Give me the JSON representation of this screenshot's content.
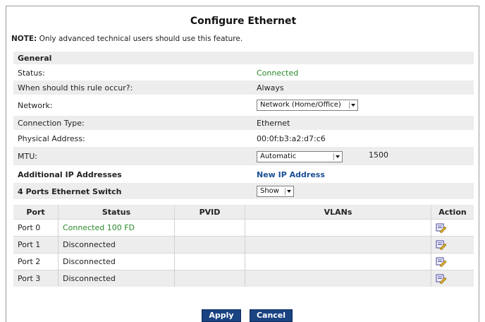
{
  "page": {
    "title": "Configure Ethernet",
    "note_label": "NOTE:",
    "note_text": " Only advanced technical users should use this feature."
  },
  "general": {
    "header": "General",
    "status_label": "Status:",
    "status_value": "Connected",
    "rule_label": "When should this rule occur?:",
    "rule_value": "Always",
    "network_label": "Network:",
    "network_value": "Network (Home/Office)",
    "conn_type_label": "Connection Type:",
    "conn_type_value": "Ethernet",
    "phys_addr_label": "Physical Address:",
    "phys_addr_value": "00:0f:b3:a2:d7:c6",
    "mtu_label": "MTU:",
    "mtu_mode": "Automatic",
    "mtu_value": "1500"
  },
  "additional_ip": {
    "label": "Additional IP Addresses",
    "link": "New IP Address"
  },
  "switch": {
    "label": "4 Ports Ethernet Switch",
    "toggle_value": "Show"
  },
  "ports_table": {
    "headers": [
      "Port",
      "Status",
      "PVID",
      "VLANs",
      "Action"
    ],
    "rows": [
      {
        "port": "Port 0",
        "status": "Connected 100 FD",
        "pvid": "",
        "vlans": ""
      },
      {
        "port": "Port 1",
        "status": "Disconnected",
        "pvid": "",
        "vlans": ""
      },
      {
        "port": "Port 2",
        "status": "Disconnected",
        "pvid": "",
        "vlans": ""
      },
      {
        "port": "Port 3",
        "status": "Disconnected",
        "pvid": "",
        "vlans": ""
      }
    ]
  },
  "buttons": {
    "apply": "Apply",
    "cancel": "Cancel"
  },
  "colors": {
    "connected": "#2a8a2a",
    "link": "#1a4f96",
    "button": "#1a4382",
    "row_alt": "#ededed"
  },
  "icons": {
    "action": "edit-icon"
  }
}
